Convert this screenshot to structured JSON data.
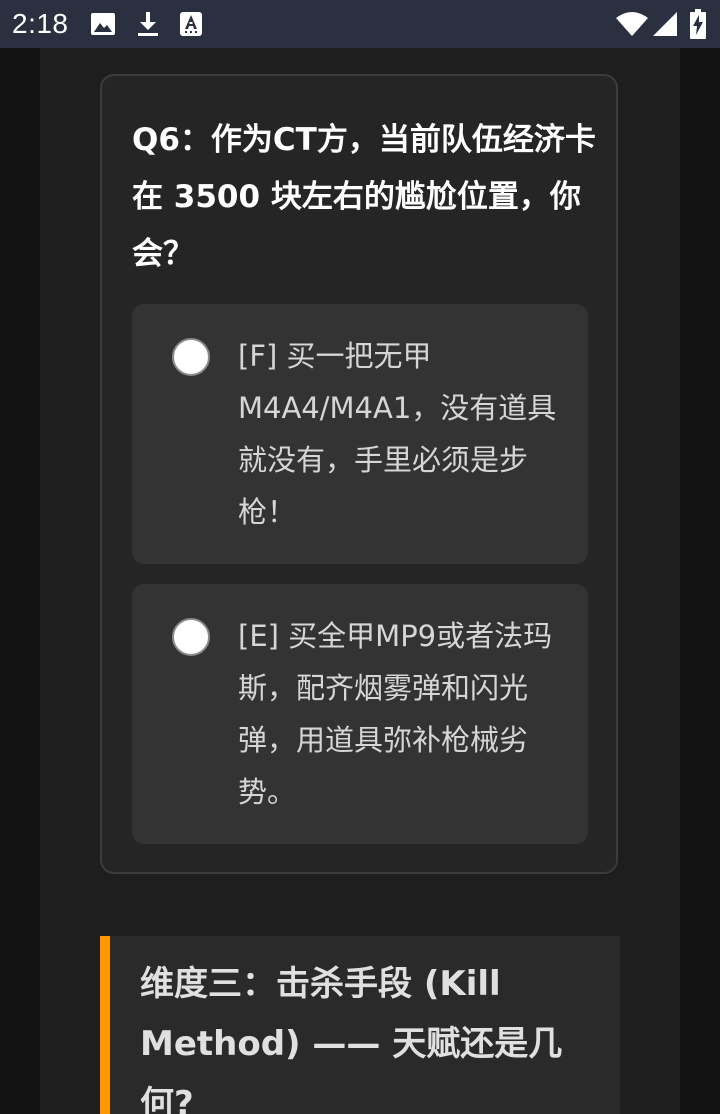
{
  "status_bar": {
    "time": "2:18",
    "left_icons": [
      "image-icon",
      "download-icon",
      "text-format-icon"
    ],
    "right_icons": [
      "wifi-icon",
      "cellular-signal-icon",
      "battery-charging-icon"
    ]
  },
  "question": {
    "title": "Q6：作为CT方，当前队伍经济卡在 3500 块左右的尴尬位置，你会？",
    "options": [
      {
        "label": "[F] 买一把无甲M4A4/M4A1，没有道具就没有，手里必须是步枪！",
        "selected": false
      },
      {
        "label": "[E] 买全甲MP9或者法玛斯，配齐烟雾弹和闪光弹，用道具弥补枪械劣势。",
        "selected": false
      }
    ]
  },
  "section": {
    "title": "维度三：击杀手段 (Kill Method) —— 天赋还是几何?"
  },
  "colors": {
    "background": "#1e1e1e",
    "card": "#252525",
    "option": "#333333",
    "accent": "#ff9800",
    "status_bar": "#2b3040"
  }
}
